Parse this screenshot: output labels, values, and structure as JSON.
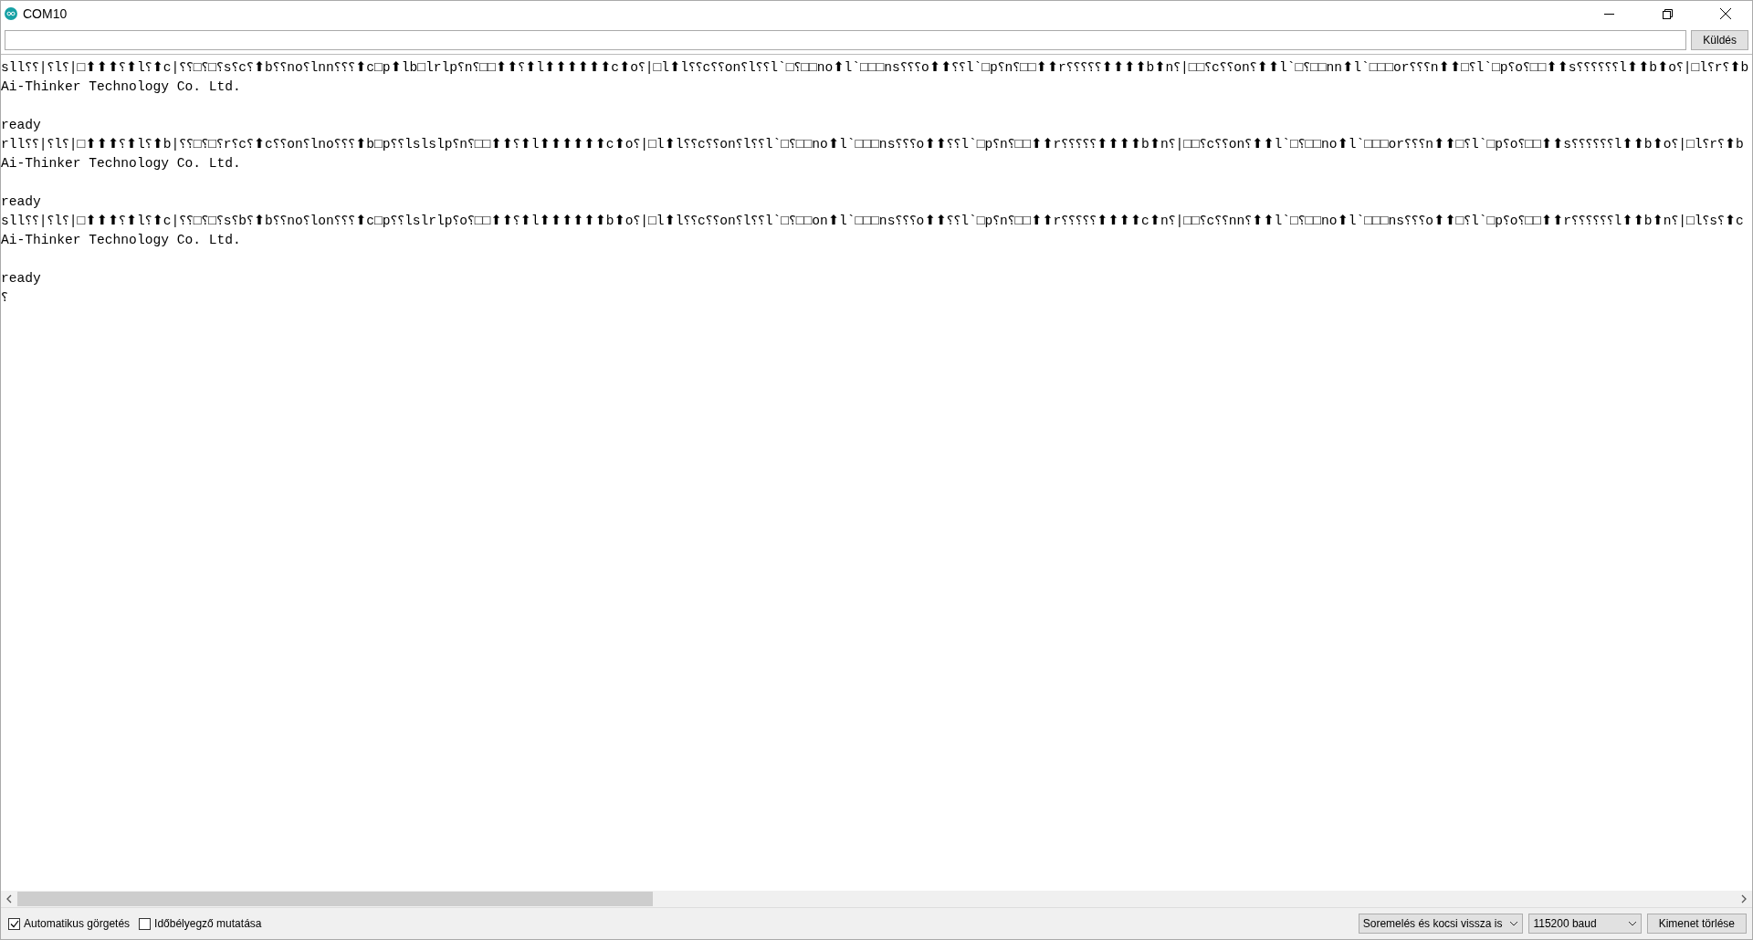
{
  "window": {
    "title": "COM10"
  },
  "send": {
    "button": "Küldés"
  },
  "output": {
    "blocks": [
      {
        "lines": [
          "sll⸮⸮|⸮l⸮|□⬆⬆⬆⸮⬆l⸮⬆c|⸮⸮□⸮□⸮s⸮c⸮⬆b⸮⸮no⸮lnn⸮⸮⸮⬆c□p⬆lb□lrlp⸮n⸮□□⬆⬆⸮⬆l⬆⬆⬆⬆⬆⬆c⬆o⸮|□l⬆l⸮⸮c⸮⸮on⸮l⸮⸮l`□⸮□□no⬆l`□□□ns⸮⸮⸮o⬆⬆⸮⸮l`□p⸮n⸮□□⬆⬆r⸮⸮⸮⸮⸮⬆⬆⬆⬆b⬆n⸮|□□⸮c⸮⸮on⸮⬆⬆l`□⸮□□nn⬆l`□□□or⸮⸮⸮n⬆⬆□⸮l`□p⸮o⸮□□⬆⬆s⸮⸮⸮⸮⸮⸮l⬆⬆b⬆o⸮|□l⸮r⸮⬆b",
          "Ai-Thinker Technology Co. Ltd."
        ]
      },
      {
        "lines": [
          "ready",
          "rll⸮⸮|⸮l⸮|□⬆⬆⬆⸮⬆l⸮⬆b|⸮⸮□⸮□⸮r⸮c⸮⬆c⸮⸮on⸮lno⸮⸮⸮⬆b□p⸮⸮lslslp⸮n⸮□□⬆⬆⸮⬆l⬆⬆⬆⬆⬆⬆c⬆o⸮|□l⬆l⸮⸮c⸮⸮on⸮l⸮⸮l`□⸮□□no⬆l`□□□ns⸮⸮⸮o⬆⬆⸮⸮l`□p⸮n⸮□□⬆⬆r⸮⸮⸮⸮⸮⬆⬆⬆⬆b⬆n⸮|□□⸮c⸮⸮on⸮⬆⬆l`□⸮□□no⬆l`□□□or⸮⸮⸮n⬆⬆□⸮l`□p⸮o⸮□□⬆⬆s⸮⸮⸮⸮⸮⸮l⬆⬆b⬆o⸮|□l⸮r⸮⬆b",
          "Ai-Thinker Technology Co. Ltd."
        ]
      },
      {
        "lines": [
          "ready",
          "sll⸮⸮|⸮l⸮|□⬆⬆⬆⸮⬆l⸮⬆c|⸮⸮□⸮□⸮s⸮b⸮⬆b⸮⸮no⸮lon⸮⸮⸮⬆c□p⸮⸮lslrlp⸮o⸮□□⬆⬆⸮⬆l⬆⬆⬆⬆⬆⬆b⬆o⸮|□l⬆l⸮⸮c⸮⸮on⸮l⸮⸮l`□⸮□□on⬆l`□□□ns⸮⸮⸮o⬆⬆⸮⸮l`□p⸮n⸮□□⬆⬆r⸮⸮⸮⸮⸮⬆⬆⬆⬆c⬆n⸮|□□⸮c⸮⸮nn⸮⬆⬆l`□⸮□□no⬆l`□□□ns⸮⸮⸮o⬆⬆□⸮l`□p⸮o⸮□□⬆⬆r⸮⸮⸮⸮⸮⸮l⬆⬆b⬆n⸮|□l⸮s⸮⬆c",
          "Ai-Thinker Technology Co. Ltd."
        ]
      },
      {
        "lines": [
          "ready",
          "⸮"
        ]
      }
    ]
  },
  "options": [
    {
      "label": "Automatikus görgetés",
      "checked": true
    },
    {
      "label": "Időbélyegző mutatása",
      "checked": false
    }
  ],
  "line_ending": "Soremelés és kocsi vissza is",
  "baud": "115200 baud",
  "clear_button": "Kimenet törlése"
}
